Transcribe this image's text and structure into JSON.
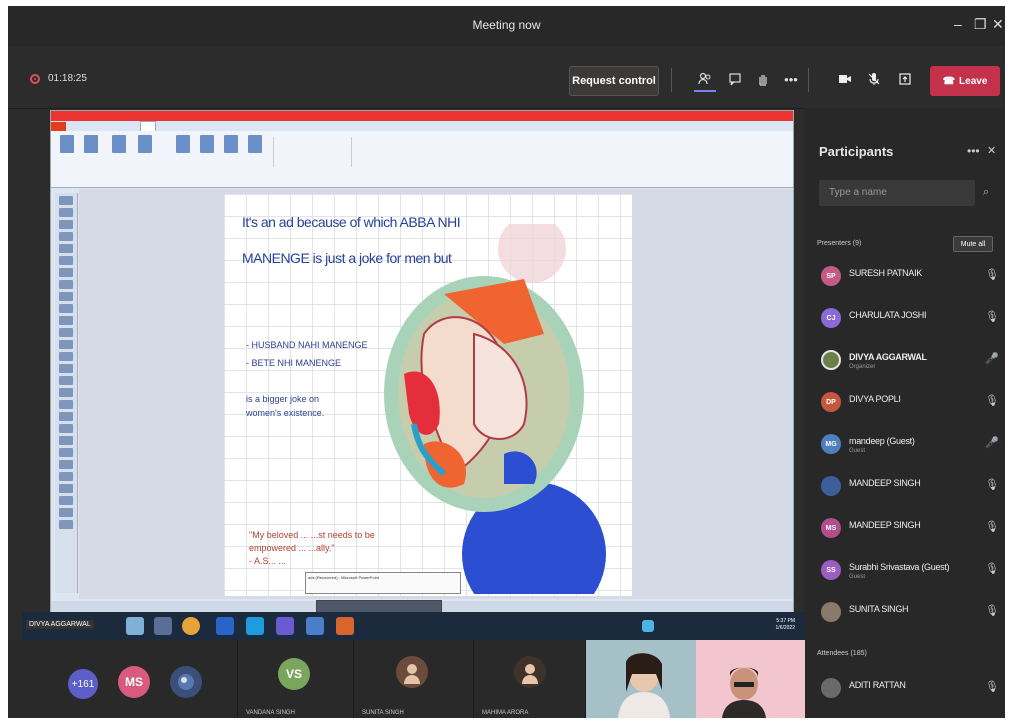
{
  "window": {
    "title": "Meeting now",
    "minimize": "–",
    "maximize": "❐",
    "close": "✕"
  },
  "toolbar": {
    "timer": "01:18:25",
    "request_control": "Request control",
    "leave": "Leave",
    "icons": [
      "people-icon",
      "chat-icon",
      "raise-hand-icon",
      "more-icon",
      "camera-icon",
      "mic-icon",
      "share-icon"
    ]
  },
  "colors": {
    "leave": "#c4314b",
    "accent": "#5b5fc7",
    "slide_text": "#27419a",
    "quote_text": "#b5402f"
  },
  "slide": {
    "line1": "It's an ad because of which ABBA NHI",
    "line2": "MANENGE is just a joke for men but",
    "bullet1": "- HUSBAND NAHI MANENGE",
    "bullet2": "- BETE NHI MANENGE",
    "line5": "is a bigger joke on",
    "line6": "women's existence.",
    "quote1": "\"My beloved ... ...st needs to be",
    "quote2": "empowered ... ...ally.\"",
    "quote3": "- A.S... ...",
    "tooltip": "ads (Recovered) - Microsoft PowerPoint"
  },
  "taskbar": {
    "presenter_label": "DIVYA AGGARWAL",
    "clock_time": "5:37 PM",
    "clock_date": "1/6/2022"
  },
  "gallery": {
    "more_label": "+161",
    "tiles": [
      {
        "initials": "MS",
        "name": ""
      },
      {
        "initials": "",
        "name": ""
      },
      {
        "initials": "VS",
        "name": "VANDANA SINGH"
      },
      {
        "initials": "",
        "name": "SUNITA SINGH"
      },
      {
        "initials": "",
        "name": "MAHIMA ARORA"
      },
      {
        "initials": "",
        "name": ""
      },
      {
        "initials": "",
        "name": ""
      }
    ]
  },
  "panel": {
    "title": "Participants",
    "search_placeholder": "Type a name",
    "presenters_label": "Presenters (9)",
    "mute_all": "Mute all",
    "attendees_label": "Attendees (185)",
    "participants": [
      {
        "initials": "SP",
        "name": "SURESH PATNAIK",
        "role": "",
        "color": "#c45a86"
      },
      {
        "initials": "CJ",
        "name": "CHARULATA JOSHI",
        "role": "",
        "color": "#8a6ad4"
      },
      {
        "initials": "",
        "name": "DIVYA AGGARWAL",
        "role": "Organizer",
        "color": "#6b7f4a"
      },
      {
        "initials": "DP",
        "name": "DIVYA POPLI",
        "role": "",
        "color": "#c4573d"
      },
      {
        "initials": "MG",
        "name": "mandeep (Guest)",
        "role": "Guest",
        "color": "#4e7fbf"
      },
      {
        "initials": "",
        "name": "MANDEEP SINGH",
        "role": "",
        "color": "#3c5f9c"
      },
      {
        "initials": "MS",
        "name": "MANDEEP SINGH",
        "role": "",
        "color": "#b14f8c"
      },
      {
        "initials": "SS",
        "name": "Surabhi Srivastava (Guest)",
        "role": "Guest",
        "color": "#9a5dc2"
      },
      {
        "initials": "",
        "name": "SUNITA SINGH",
        "role": "",
        "color": "#8a7a6a"
      },
      {
        "initials": "",
        "name": "ADITI RATTAN",
        "role": "",
        "color": "#6a6a6a"
      }
    ]
  }
}
